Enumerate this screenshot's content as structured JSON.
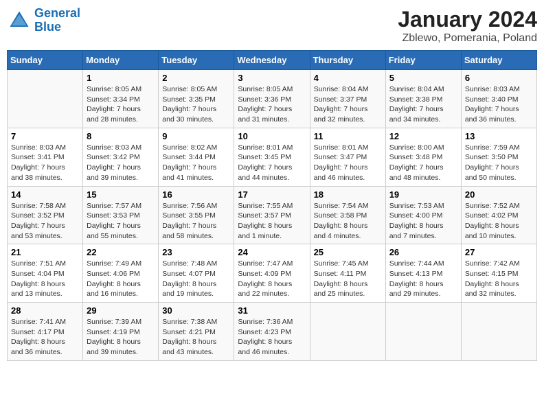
{
  "header": {
    "logo_line1": "General",
    "logo_line2": "Blue",
    "title": "January 2024",
    "subtitle": "Zblewo, Pomerania, Poland"
  },
  "days_of_week": [
    "Sunday",
    "Monday",
    "Tuesday",
    "Wednesday",
    "Thursday",
    "Friday",
    "Saturday"
  ],
  "weeks": [
    [
      {
        "day": "",
        "content": ""
      },
      {
        "day": "1",
        "content": "Sunrise: 8:05 AM\nSunset: 3:34 PM\nDaylight: 7 hours\nand 28 minutes."
      },
      {
        "day": "2",
        "content": "Sunrise: 8:05 AM\nSunset: 3:35 PM\nDaylight: 7 hours\nand 30 minutes."
      },
      {
        "day": "3",
        "content": "Sunrise: 8:05 AM\nSunset: 3:36 PM\nDaylight: 7 hours\nand 31 minutes."
      },
      {
        "day": "4",
        "content": "Sunrise: 8:04 AM\nSunset: 3:37 PM\nDaylight: 7 hours\nand 32 minutes."
      },
      {
        "day": "5",
        "content": "Sunrise: 8:04 AM\nSunset: 3:38 PM\nDaylight: 7 hours\nand 34 minutes."
      },
      {
        "day": "6",
        "content": "Sunrise: 8:03 AM\nSunset: 3:40 PM\nDaylight: 7 hours\nand 36 minutes."
      }
    ],
    [
      {
        "day": "7",
        "content": "Sunrise: 8:03 AM\nSunset: 3:41 PM\nDaylight: 7 hours\nand 38 minutes."
      },
      {
        "day": "8",
        "content": "Sunrise: 8:03 AM\nSunset: 3:42 PM\nDaylight: 7 hours\nand 39 minutes."
      },
      {
        "day": "9",
        "content": "Sunrise: 8:02 AM\nSunset: 3:44 PM\nDaylight: 7 hours\nand 41 minutes."
      },
      {
        "day": "10",
        "content": "Sunrise: 8:01 AM\nSunset: 3:45 PM\nDaylight: 7 hours\nand 44 minutes."
      },
      {
        "day": "11",
        "content": "Sunrise: 8:01 AM\nSunset: 3:47 PM\nDaylight: 7 hours\nand 46 minutes."
      },
      {
        "day": "12",
        "content": "Sunrise: 8:00 AM\nSunset: 3:48 PM\nDaylight: 7 hours\nand 48 minutes."
      },
      {
        "day": "13",
        "content": "Sunrise: 7:59 AM\nSunset: 3:50 PM\nDaylight: 7 hours\nand 50 minutes."
      }
    ],
    [
      {
        "day": "14",
        "content": "Sunrise: 7:58 AM\nSunset: 3:52 PM\nDaylight: 7 hours\nand 53 minutes."
      },
      {
        "day": "15",
        "content": "Sunrise: 7:57 AM\nSunset: 3:53 PM\nDaylight: 7 hours\nand 55 minutes."
      },
      {
        "day": "16",
        "content": "Sunrise: 7:56 AM\nSunset: 3:55 PM\nDaylight: 7 hours\nand 58 minutes."
      },
      {
        "day": "17",
        "content": "Sunrise: 7:55 AM\nSunset: 3:57 PM\nDaylight: 8 hours\nand 1 minute."
      },
      {
        "day": "18",
        "content": "Sunrise: 7:54 AM\nSunset: 3:58 PM\nDaylight: 8 hours\nand 4 minutes."
      },
      {
        "day": "19",
        "content": "Sunrise: 7:53 AM\nSunset: 4:00 PM\nDaylight: 8 hours\nand 7 minutes."
      },
      {
        "day": "20",
        "content": "Sunrise: 7:52 AM\nSunset: 4:02 PM\nDaylight: 8 hours\nand 10 minutes."
      }
    ],
    [
      {
        "day": "21",
        "content": "Sunrise: 7:51 AM\nSunset: 4:04 PM\nDaylight: 8 hours\nand 13 minutes."
      },
      {
        "day": "22",
        "content": "Sunrise: 7:49 AM\nSunset: 4:06 PM\nDaylight: 8 hours\nand 16 minutes."
      },
      {
        "day": "23",
        "content": "Sunrise: 7:48 AM\nSunset: 4:07 PM\nDaylight: 8 hours\nand 19 minutes."
      },
      {
        "day": "24",
        "content": "Sunrise: 7:47 AM\nSunset: 4:09 PM\nDaylight: 8 hours\nand 22 minutes."
      },
      {
        "day": "25",
        "content": "Sunrise: 7:45 AM\nSunset: 4:11 PM\nDaylight: 8 hours\nand 25 minutes."
      },
      {
        "day": "26",
        "content": "Sunrise: 7:44 AM\nSunset: 4:13 PM\nDaylight: 8 hours\nand 29 minutes."
      },
      {
        "day": "27",
        "content": "Sunrise: 7:42 AM\nSunset: 4:15 PM\nDaylight: 8 hours\nand 32 minutes."
      }
    ],
    [
      {
        "day": "28",
        "content": "Sunrise: 7:41 AM\nSunset: 4:17 PM\nDaylight: 8 hours\nand 36 minutes."
      },
      {
        "day": "29",
        "content": "Sunrise: 7:39 AM\nSunset: 4:19 PM\nDaylight: 8 hours\nand 39 minutes."
      },
      {
        "day": "30",
        "content": "Sunrise: 7:38 AM\nSunset: 4:21 PM\nDaylight: 8 hours\nand 43 minutes."
      },
      {
        "day": "31",
        "content": "Sunrise: 7:36 AM\nSunset: 4:23 PM\nDaylight: 8 hours\nand 46 minutes."
      },
      {
        "day": "",
        "content": ""
      },
      {
        "day": "",
        "content": ""
      },
      {
        "day": "",
        "content": ""
      }
    ]
  ]
}
